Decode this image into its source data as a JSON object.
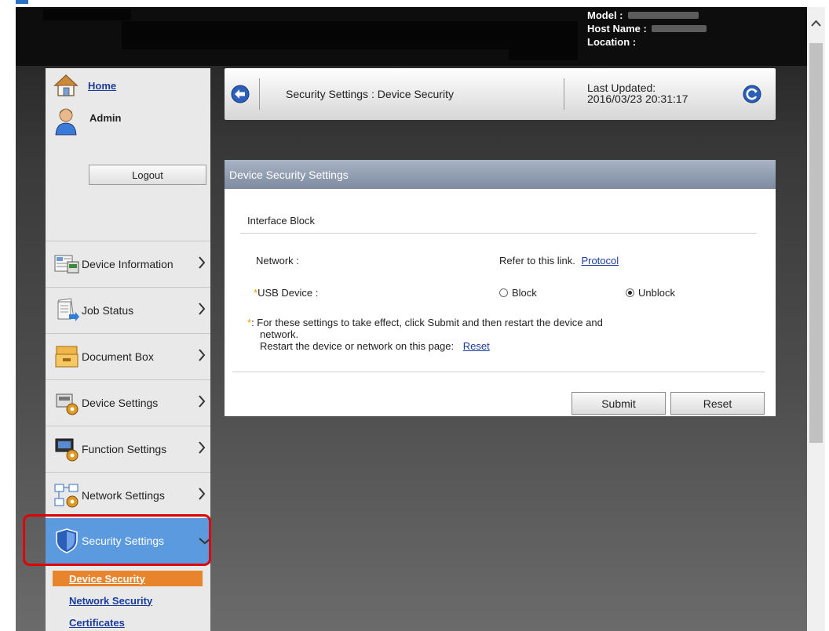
{
  "header": {
    "model_label": "Model :",
    "host_label": "Host Name :",
    "location_label": "Location :"
  },
  "sidebar": {
    "home": "Home",
    "admin": "Admin",
    "logout": "Logout",
    "items": [
      {
        "label": "Device Information",
        "icon": "device-information-icon",
        "state": "collapsed"
      },
      {
        "label": "Job Status",
        "icon": "job-status-icon",
        "state": "collapsed"
      },
      {
        "label": "Document Box",
        "icon": "document-box-icon",
        "state": "collapsed"
      },
      {
        "label": "Device Settings",
        "icon": "device-settings-icon",
        "state": "collapsed"
      },
      {
        "label": "Function Settings",
        "icon": "function-settings-icon",
        "state": "collapsed"
      },
      {
        "label": "Network Settings",
        "icon": "network-settings-icon",
        "state": "collapsed"
      },
      {
        "label": "Security Settings",
        "icon": "shield-icon",
        "state": "expanded"
      }
    ],
    "subitems": [
      "Device Security",
      "Network Security",
      "Certificates"
    ],
    "current_subitem": "Device Security"
  },
  "titlebar": {
    "title": "Security Settings : Device Security",
    "last_updated_label": "Last Updated:",
    "last_updated_value": "2016/03/23 20:31:17"
  },
  "panel": {
    "heading": "Device Security Settings",
    "section": "Interface Block",
    "network_label": "Network :",
    "network_hint": "Refer to this link.",
    "network_link": "Protocol",
    "usb_required_mark": "*",
    "usb_label": "USB Device :",
    "usb_options": [
      "Block",
      "Unblock"
    ],
    "usb_selected": "Unblock",
    "note_star": "*",
    "note_line1": ": For these settings to take effect, click Submit and then restart the device and",
    "note_line2": "network.",
    "note_line3": "Restart the device or network on this page:",
    "note_link": "Reset",
    "submit": "Submit",
    "reset": "Reset"
  },
  "colors": {
    "active_nav": "#5c9ae0",
    "current_sub": "#e8842b",
    "link": "#1a3b9a",
    "highlight": "#e00000",
    "required": "#e8a000"
  }
}
